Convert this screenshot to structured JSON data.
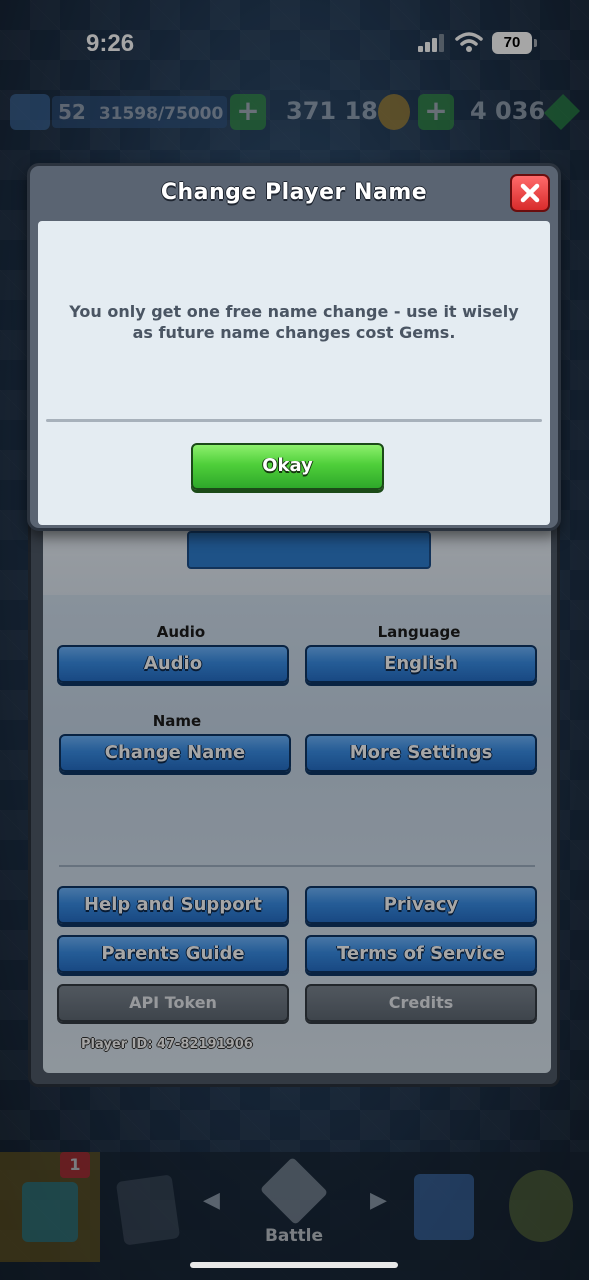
{
  "status_bar": {
    "time": "9:26",
    "battery": "70"
  },
  "resource_bar": {
    "level": "52",
    "xp": "31598/75000",
    "gold": "371 186",
    "gems": "4 036"
  },
  "modal": {
    "title": "Change Player Name",
    "message": "You only get one free name change - use it wisely as future name changes cost Gems.",
    "okay_label": "Okay"
  },
  "settings": {
    "audio_section": "Audio",
    "audio_button": "Audio",
    "language_section": "Language",
    "language_button": "English",
    "name_section": "Name",
    "change_name_button": "Change Name",
    "more_settings_button": "More Settings",
    "help_button": "Help and Support",
    "privacy_button": "Privacy",
    "parents_button": "Parents Guide",
    "terms_button": "Terms of Service",
    "api_button": "API Token",
    "credits_button": "Credits",
    "player_id": "Player ID: 47-82191906"
  },
  "bottom_nav": {
    "shop_badge": "1",
    "battle_label": "Battle"
  },
  "colors": {
    "primary_button": "#3a8fe8",
    "confirm_button": "#4fcf3a",
    "close_button": "#d82b2b"
  }
}
